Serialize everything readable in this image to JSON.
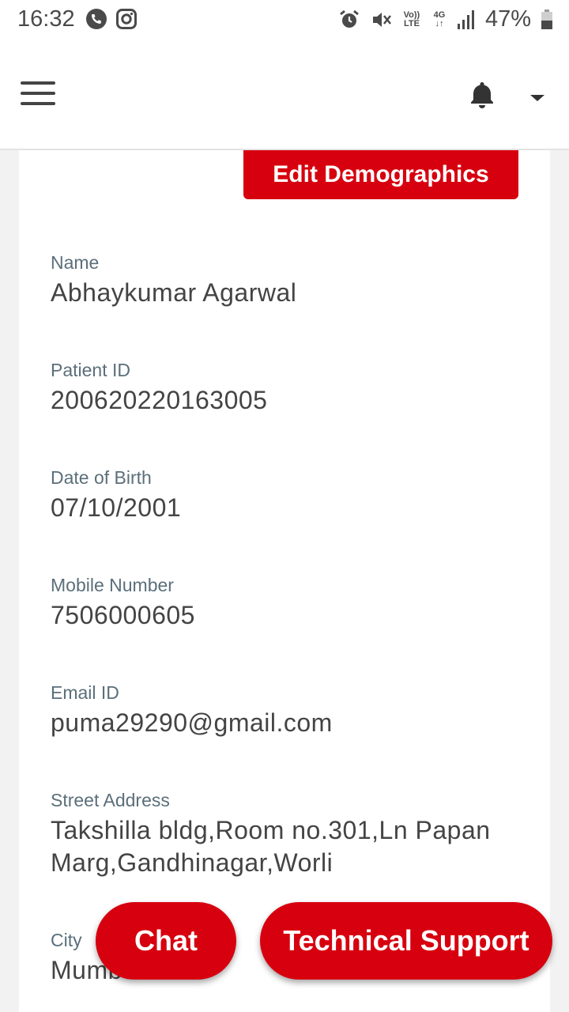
{
  "status_bar": {
    "time": "16:32",
    "battery": "47%",
    "volte_top": "Vo))",
    "volte_bottom": "LTE",
    "network": "4G"
  },
  "header": {
    "menu_icon": "hamburger-icon",
    "notification_icon": "bell-icon",
    "dropdown_icon": "caret-down-icon"
  },
  "profile": {
    "edit_button": "Edit Demographics",
    "fields": [
      {
        "label": "Name",
        "value": "Abhaykumar Agarwal"
      },
      {
        "label": "Patient ID",
        "value": "200620220163005"
      },
      {
        "label": "Date of Birth",
        "value": "07/10/2001"
      },
      {
        "label": "Mobile Number",
        "value": "7506000605"
      },
      {
        "label": "Email ID",
        "value": "puma29290@gmail.com"
      },
      {
        "label": "Street Address",
        "value": "Takshilla bldg,Room no.301,Ln Papan Marg,Gandhinagar,Worli"
      },
      {
        "label": "City",
        "value": "Mumbai"
      }
    ]
  },
  "actions": {
    "chat": "Chat",
    "support": "Technical Support"
  },
  "colors": {
    "accent": "#d7000f",
    "label": "#5b6f7a",
    "value": "#444444"
  }
}
